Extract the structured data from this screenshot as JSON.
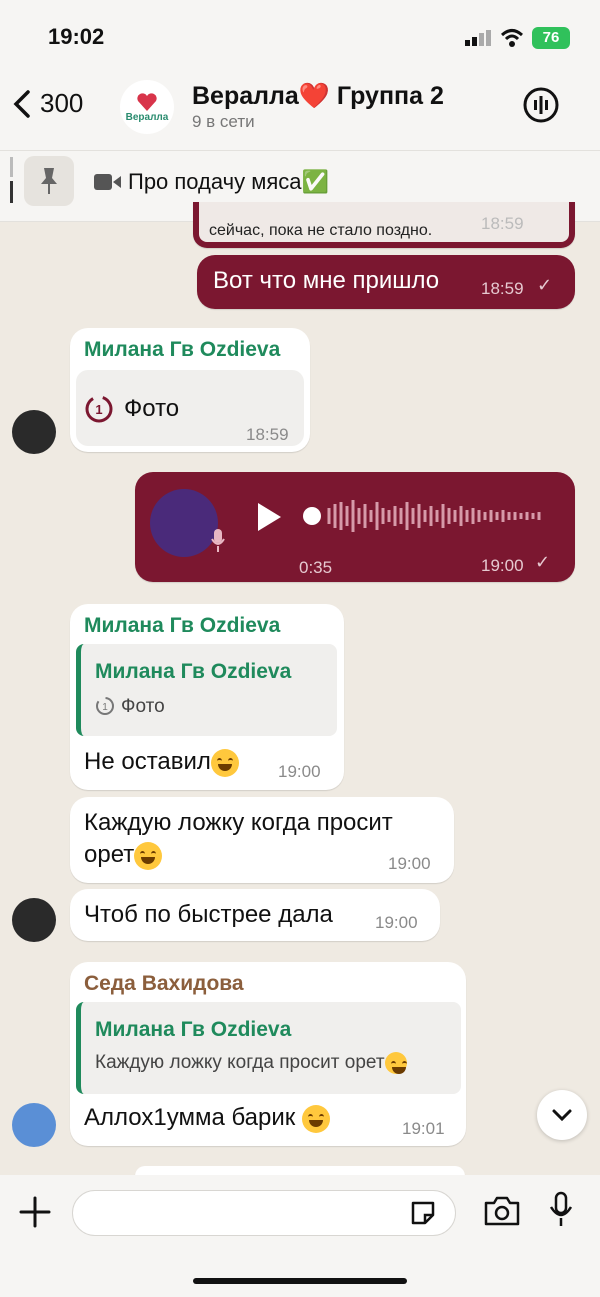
{
  "status": {
    "time": "19:02",
    "battery": "76"
  },
  "header": {
    "back_count": "300",
    "title": "Beралла❤️ Группа 2",
    "subtitle": "9 в сети",
    "logo_text": "Beралла"
  },
  "pinned": {
    "text": "Про подачу мяса✅"
  },
  "messages": {
    "m0_text": "сейчас, пока не стало поздно.",
    "m0_time": "18:59",
    "m1_text": "Вот что мне пришло",
    "m1_time": "18:59",
    "m2_sender": "Милана Гв Ozdieva",
    "m2_text": "Фото",
    "m2_time": "18:59",
    "m3_duration": "0:35",
    "m3_time": "19:00",
    "m4_sender": "Милана Гв Ozdieva",
    "m4_quote_sender": "Милана Гв Ozdieva",
    "m4_quote_text": "Фото",
    "m4_text": "Не оставил",
    "m4_time": "19:00",
    "m5_line1": "Каждую ложку когда просит",
    "m5_line2": "орет",
    "m5_time": "19:00",
    "m6_text": "Чтоб по быстрее дала",
    "m6_time": "19:00",
    "m7_sender": "Седа Вахидова",
    "m7_quote_sender": "Милана Гв Ozdieva",
    "m7_quote_text": "Каждую ложку когда просит орет",
    "m7_text": "Аллох1умма барик ",
    "m7_time": "19:01"
  },
  "colors": {
    "outgoing": "#7b1730",
    "sender_green": "#1f8a5c",
    "sender_brown": "#8b5e3c"
  },
  "icons": [
    "back-chevron-icon",
    "voice-call-icon",
    "pin-icon",
    "video-icon",
    "play-icon",
    "microphone-icon",
    "plus-icon",
    "sticker-icon",
    "camera-icon",
    "chevron-down-icon"
  ]
}
